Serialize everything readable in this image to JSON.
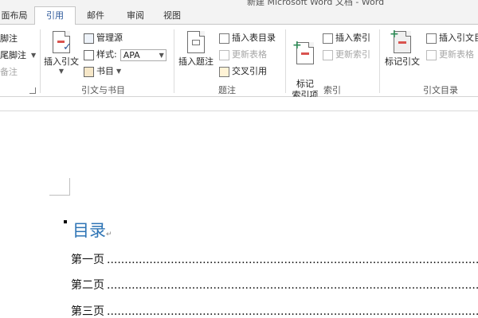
{
  "window": {
    "title": "新建 Microsoft Word 文档 - Word"
  },
  "tabs": [
    {
      "label": "面布局",
      "active": false
    },
    {
      "label": "引用",
      "active": true
    },
    {
      "label": "邮件",
      "active": false
    },
    {
      "label": "审阅",
      "active": false
    },
    {
      "label": "视图",
      "active": false
    }
  ],
  "ribbon": {
    "partial_group": {
      "items": [
        "脚注",
        "尾脚注",
        "备注"
      ]
    },
    "citations_group": {
      "label": "引文与书目",
      "insert_citation": "插入引文",
      "manage_sources": "管理源",
      "style_label": "样式:",
      "style_value": "APA",
      "bibliography": "书目"
    },
    "captions_group": {
      "label": "题注",
      "insert_caption": "插入题注",
      "insert_table_of_figures": "插入表目录",
      "update_table": "更新表格",
      "cross_reference": "交叉引用"
    },
    "index_group": {
      "label": "索引",
      "mark_entry": "标记\n索引项",
      "insert_index": "插入索引",
      "update_index": "更新索引"
    },
    "toa_group": {
      "label": "引文目录",
      "mark_citation": "标记引文",
      "insert_toa": "插入引文目",
      "update_table": "更新表格"
    }
  },
  "document": {
    "para_mark": "↵",
    "toc_title": "目录",
    "toc_entries": [
      {
        "text": "第一页"
      },
      {
        "text": "第二页"
      },
      {
        "text": "第三页"
      }
    ],
    "leader": "......................................................................................................................"
  },
  "colors": {
    "accent": "#2b579a",
    "heading": "#2e74b5",
    "icon_green": "#2e8b57",
    "icon_red": "#d9534f"
  }
}
